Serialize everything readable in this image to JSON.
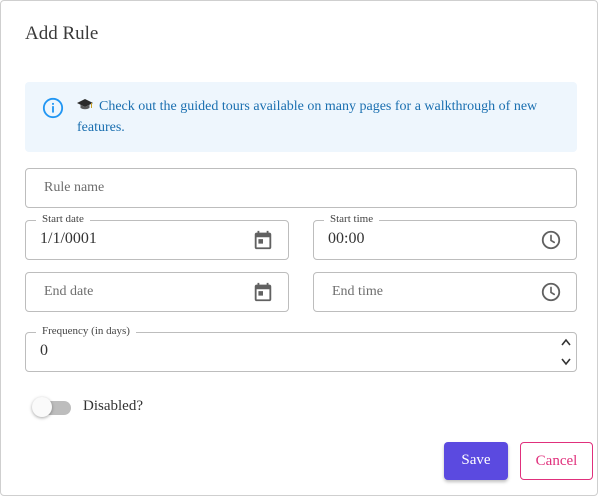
{
  "dialog": {
    "title": "Add Rule",
    "info": {
      "text": "Check out the guided tours available on many pages for a walkthrough of new features.",
      "icon": "info-circle-icon",
      "accent_color": "#1a6fb0",
      "background": "#eef6fd"
    },
    "fields": {
      "rule_name": {
        "placeholder": "Rule name",
        "value": ""
      },
      "start_date": {
        "label": "Start date",
        "value": "1/1/0001",
        "icon": "calendar-icon"
      },
      "start_time": {
        "label": "Start time",
        "value": "00:00",
        "icon": "clock-icon"
      },
      "end_date": {
        "placeholder": "End date",
        "value": "",
        "icon": "calendar-icon"
      },
      "end_time": {
        "placeholder": "End time",
        "value": "",
        "icon": "clock-icon"
      },
      "frequency": {
        "label": "Frequency (in days)",
        "value": "0"
      }
    },
    "toggle": {
      "label": "Disabled?",
      "checked": false
    },
    "buttons": {
      "save": "Save",
      "cancel": "Cancel",
      "save_color": "#5b4ae0",
      "cancel_color": "#e0307c"
    }
  }
}
